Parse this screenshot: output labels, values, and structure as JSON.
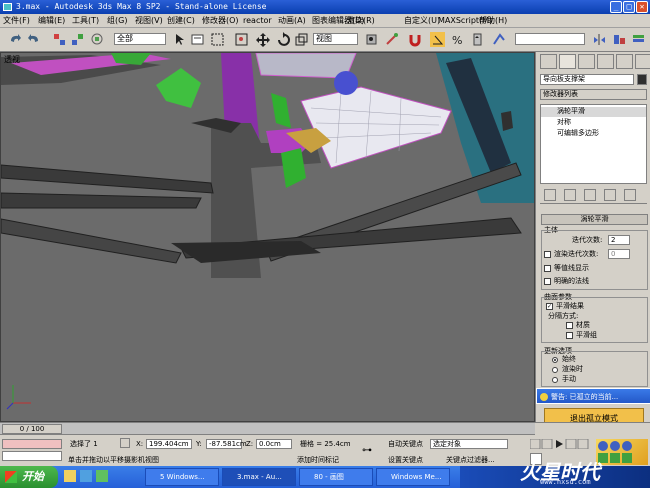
{
  "window": {
    "title": "3.max - Autodesk 3ds Max 8 SP2 - Stand-alone License"
  },
  "menu": [
    "文件(F)",
    "编辑(E)",
    "工具(T)",
    "组(G)",
    "视图(V)",
    "创建(C)",
    "修改器(O)",
    "reactor",
    "动画(A)",
    "图表编辑器(D)",
    "渲染(R)",
    "自定义(U)",
    "MAXScript(M)",
    "帮助(H)"
  ],
  "toolbar": {
    "selection_filter": "全部",
    "ref_coord": "视图"
  },
  "viewport": {
    "label": "透视"
  },
  "panel": {
    "object_name": "导向板支撑架",
    "modifier_list": "修改器列表",
    "stack": [
      "涡轮平滑",
      "对称",
      "可编辑多边形"
    ],
    "rollout_title": "涡轮平滑",
    "main_group": "主体",
    "iterations_label": "迭代次数:",
    "iterations_value": "2",
    "render_iters_label": "渲染迭代次数:",
    "render_iters_value": "0",
    "isoline": "等值线显示",
    "explicit_normals": "明确的法线",
    "surface_group": "曲面参数",
    "smooth_result": "平滑结果",
    "separate_by": "分隔方式:",
    "materials": "材质",
    "smoothing_groups": "平滑组",
    "update_group": "更新选项",
    "always": "始终",
    "when_rendering": "渲染时",
    "manually": "手动",
    "warning": "警告: 已孤立的当前...",
    "exit_isolation": "退出孤立模式"
  },
  "bottom": {
    "frame": "0 / 100",
    "selected": "选择了 1",
    "x_label": "X:",
    "x_value": "199.404cm",
    "y_label": "Y:",
    "y_value": "-87.581cm",
    "z_label": "Z:",
    "z_value": "0.0cm",
    "grid": "栅格 = 25.4cm",
    "autokey": "自动关键点",
    "set_key": "设置关键点",
    "selected_obj": "选定对象",
    "key_filter": "关键点过滤器...",
    "prompt": "单击并拖动以平移摄影机视图",
    "add_time_tag": "添加时间标记"
  },
  "taskbar": {
    "start": "开始",
    "tasks": [
      "5 Windows...",
      "3.max - Au...",
      "80 - 画图",
      "Windows Me..."
    ],
    "watermark": "火星时代",
    "watermark_url": "www.hxsd.com"
  },
  "colors": {
    "viewport_bg": "#6b6b6b",
    "accent_yellow": "#f2c04a",
    "taskbar_blue": "#2660d8"
  }
}
